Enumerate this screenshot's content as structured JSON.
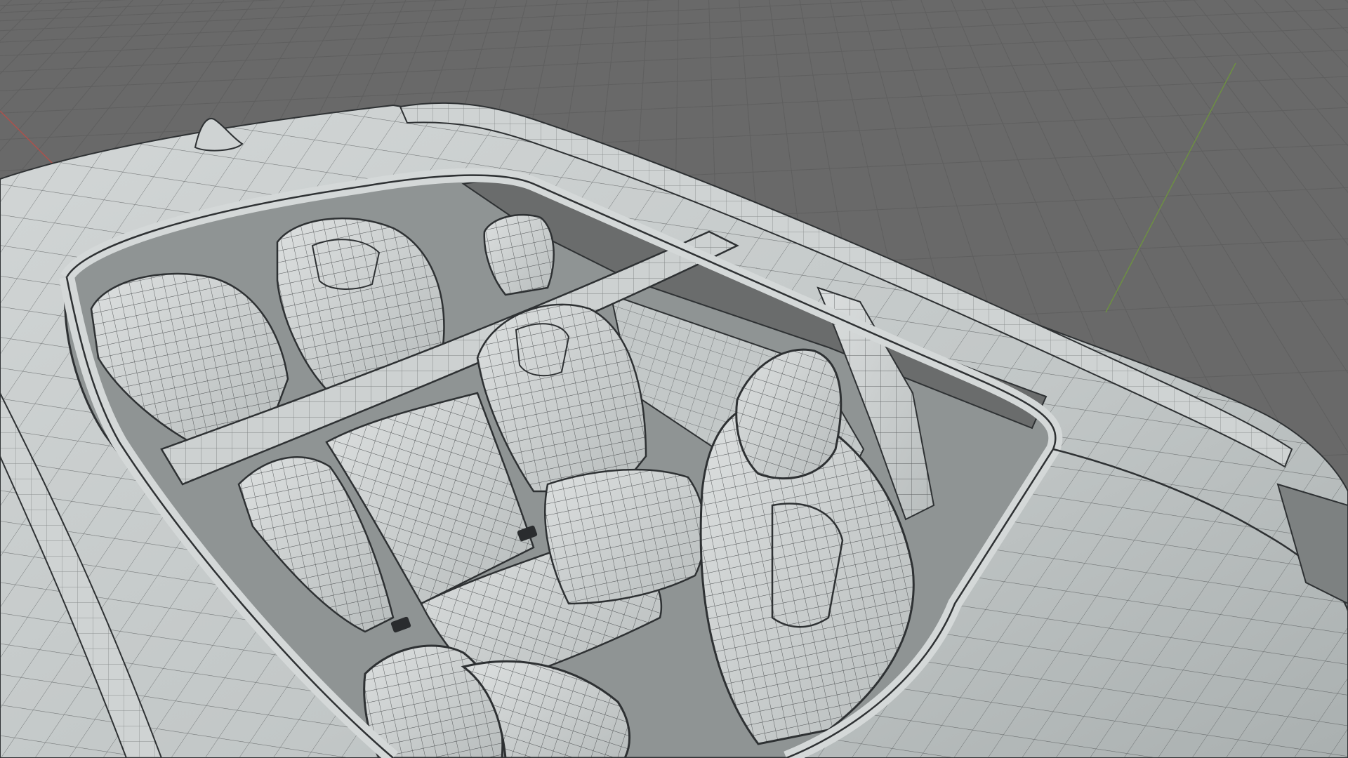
{
  "viewport": {
    "background": "#696969",
    "grid_color": "#5f5f5f",
    "axis_x_color": "#b0504a",
    "axis_y_color": "#6d9140",
    "shading": "solid-wireframe"
  },
  "model": {
    "surface_color": "#c8cccc",
    "surface_shadow_color": "#9aa1a1",
    "wire_color": "#3a3d3f",
    "objects": [
      "antenna-icon",
      "roof",
      "roof-rails",
      "roof-crossbar",
      "panoramic-roof-opening",
      "b-pillar",
      "front-seat-left",
      "front-seat-right",
      "rear-bench",
      "rear-seat-left",
      "rear-seat-right",
      "third-row-seats",
      "seat-belt-buckle-icon",
      "door-panel"
    ]
  }
}
